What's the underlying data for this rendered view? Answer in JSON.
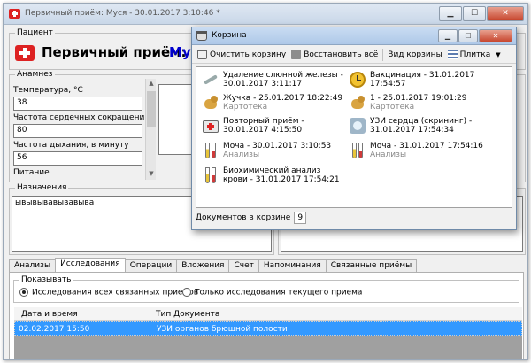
{
  "window": {
    "title": "Первичный приём: Муся - 30.01.2017 3:10:46 *",
    "controls": {
      "minimize": "▁",
      "maximize": "☐",
      "close": "✕"
    }
  },
  "patient": {
    "group_label": "Пациент",
    "heading": "Первичный приём:",
    "name_link": "Мус"
  },
  "anamnesis": {
    "group_label": "Анамнез",
    "fields": [
      {
        "label": "Температура, °С",
        "value": "38"
      },
      {
        "label": "Частота сердечных сокращений",
        "value": "80"
      },
      {
        "label": "Частота дыхания, в минуту",
        "value": "56"
      },
      {
        "label": "Питание",
        "value": ""
      }
    ]
  },
  "prescriptions": {
    "group_label": "Назначения",
    "text": "ывывывавывавыва"
  },
  "tabs": [
    "Анализы",
    "Исследования",
    "Операции",
    "Вложения",
    "Счет",
    "Напоминания",
    "Связанные приёмы"
  ],
  "active_tab_index": 1,
  "research": {
    "show_label": "Показывать",
    "radio_all": "Исследования всех связанных приемов",
    "radio_current": "Только исследования текущего приема",
    "columns": [
      "Дата и время",
      "Тип Документа"
    ],
    "rows": [
      {
        "datetime": "02.02.2017 15:50",
        "doc_type": "УЗИ органов брюшной полости"
      }
    ]
  },
  "basket": {
    "title": "Корзина",
    "toolbar": {
      "clear": "Очистить корзину",
      "restore": "Восстановить всё",
      "view": "Вид корзины",
      "tile": "Плитка"
    },
    "items": [
      {
        "title": "Удаление слюнной железы - 30.01.2017 3:11:17",
        "sub": "",
        "icon": "scalpel-icon"
      },
      {
        "title": "Вакцинация - 31.01.2017 17:54:57",
        "sub": "",
        "icon": "clock-icon"
      },
      {
        "title": "Жучка - 25.01.2017 18:22:49",
        "sub": "Картотека",
        "icon": "dog-icon"
      },
      {
        "title": "1 - 25.01.2017 19:01:29",
        "sub": "Картотека",
        "icon": "dog-icon"
      },
      {
        "title": "Повторный приём - 30.01.2017 4:15:50",
        "sub": "",
        "icon": "medkit-icon"
      },
      {
        "title": "УЗИ сердца (скрининг) - 31.01.2017 17:54:34",
        "sub": "",
        "icon": "ultrasound-icon"
      },
      {
        "title": "Моча - 30.01.2017 3:10:53",
        "sub": "Анализы",
        "icon": "test-tube-icon"
      },
      {
        "title": "Моча - 31.01.2017 17:54:16",
        "sub": "Анализы",
        "icon": "test-tube-icon"
      },
      {
        "title": "Биохимический анализ крови - 31.01.2017 17:54:21",
        "sub": "",
        "icon": "test-tube-icon"
      }
    ],
    "footer_label": "Документов в корзине",
    "count": "9"
  }
}
